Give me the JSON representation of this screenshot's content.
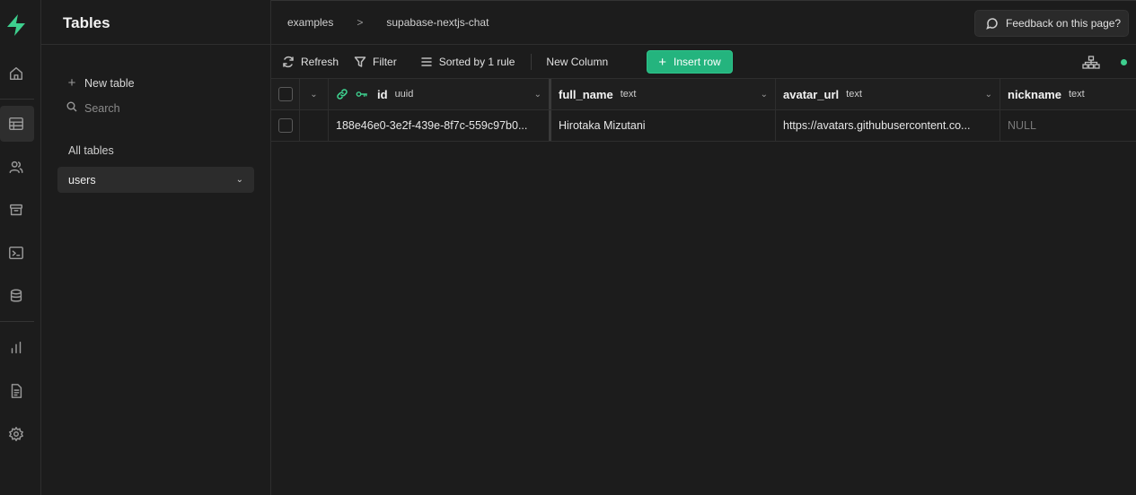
{
  "sidebar": {
    "title": "Tables",
    "new_table": "New table",
    "search_placeholder": "Search",
    "all_tables": "All tables",
    "selected_table": "users"
  },
  "breadcrumb": {
    "project": "examples",
    "repo": "supabase-nextjs-chat"
  },
  "feedback_label": "Feedback on this page?",
  "toolbar": {
    "refresh": "Refresh",
    "filter": "Filter",
    "sort": "Sorted by 1 rule",
    "new_column": "New Column",
    "insert_row": "Insert row"
  },
  "columns": [
    {
      "name": "id",
      "type": "uuid"
    },
    {
      "name": "full_name",
      "type": "text"
    },
    {
      "name": "avatar_url",
      "type": "text"
    },
    {
      "name": "nickname",
      "type": "text"
    }
  ],
  "rows": [
    {
      "id": "188e46e0-3e2f-439e-8f7c-559c97b0...",
      "full_name": "Hirotaka Mizutani",
      "avatar_url": "https://avatars.githubusercontent.co...",
      "nickname": "NULL"
    }
  ],
  "colors": {
    "accent": "#24b47e",
    "status": "#3ecf8e"
  }
}
